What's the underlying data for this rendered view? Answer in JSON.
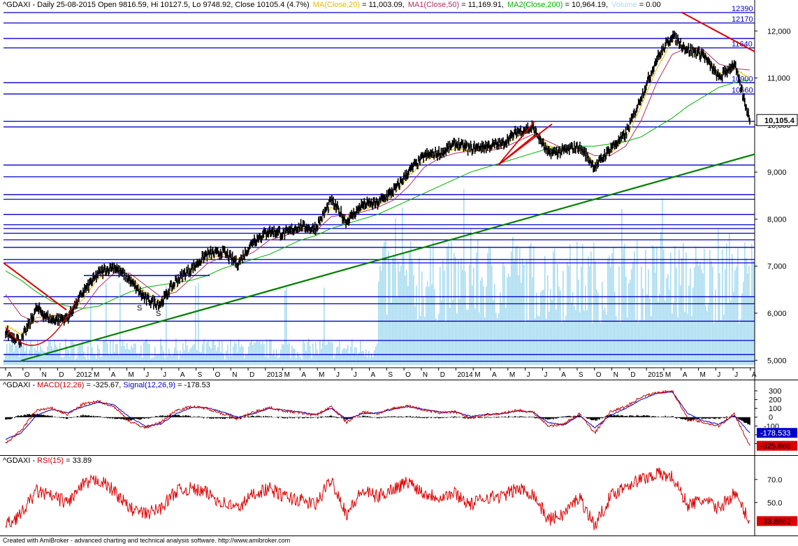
{
  "price_header": {
    "symbol_line": "^GDAXI - Daily 25-08-2015 Open 9816.59, Hi 10127.5, Lo 9748.92, Close 10105.4 (4.7%)",
    "ma20": "MA(Close,20)",
    "ma20_value": " = 11,003.09,",
    "ma50": "MA1(Close,50)",
    "ma50_value": " = 11,169.91,",
    "ma200": "MA2(Close,200)",
    "ma200_value": " = 10,964.19,",
    "volume": "Volume",
    "volume_value": " = 0.00"
  },
  "macd_header": {
    "symbol": "^GDAXI - ",
    "macd": "MACD(12,26)",
    "macd_value": " = -325.67, ",
    "signal": "Signal(12,26,9)",
    "signal_value": " = -178.53"
  },
  "rsi_header": {
    "symbol": "^GDAXI - ",
    "rsi": "RSI(15)",
    "rsi_value": " = 33.89"
  },
  "footer": "Created with AmiBroker - advanced charting and technical analysis software. http://www.amibroker.com",
  "colors": {
    "price": "#000000",
    "ma20": "#e8b800",
    "ma50": "#b03060",
    "ma200": "#00b000",
    "volume": "#a8dcf0",
    "hline": "#0000cc",
    "trend_green": "#008000",
    "trend_red": "#dd0000",
    "macd": "#cc0000",
    "signal": "#0000cc",
    "rsi": "#dd0000"
  },
  "chart_data": [
    {
      "type": "line",
      "title": "^GDAXI - Daily",
      "ylim": [
        4900,
        12450
      ],
      "y_ticks": [
        "5,000",
        "6,000",
        "7,000",
        "8,000",
        "9,000",
        "10,000",
        "11,000",
        "12,000"
      ],
      "x_labels": [
        "A",
        "O",
        "N",
        "D",
        "2012",
        "M",
        "A",
        "M",
        "J",
        "J",
        "A",
        "S",
        "O",
        "N",
        "D",
        "2013",
        "M",
        "A",
        "M",
        "J",
        "J",
        "A",
        "S",
        "O",
        "N",
        "D",
        "2014",
        "M",
        "A",
        "M",
        "J",
        "J",
        "A",
        "S",
        "O",
        "N",
        "D",
        "2015",
        "M",
        "A",
        "M",
        "J",
        "J",
        "A"
      ],
      "last_value_label": "10,105.4",
      "horizontal_levels": [
        12390,
        12170,
        11840,
        11640,
        10900,
        10660,
        10080,
        9960,
        9150,
        8900,
        8520,
        8420,
        8100,
        7880,
        7800,
        7700,
        7560,
        7400,
        7140,
        7070,
        6350,
        6200,
        5830,
        5420,
        5120,
        4980
      ],
      "level_labels": [
        "12390",
        "12170",
        "11640",
        "10900",
        "10660"
      ],
      "series": [
        {
          "name": "Close",
          "x": [
            "2011-08",
            "2011-09",
            "2011-10",
            "2011-11",
            "2011-12",
            "2012-01",
            "2012-02",
            "2012-03",
            "2012-04",
            "2012-05",
            "2012-06",
            "2012-07",
            "2012-08",
            "2012-09",
            "2012-10",
            "2012-11",
            "2012-12",
            "2013-01",
            "2013-02",
            "2013-03",
            "2013-04",
            "2013-05",
            "2013-06",
            "2013-07",
            "2013-08",
            "2013-09",
            "2013-10",
            "2013-11",
            "2013-12",
            "2014-01",
            "2014-02",
            "2014-03",
            "2014-04",
            "2014-05",
            "2014-06",
            "2014-07",
            "2014-08",
            "2014-09",
            "2014-10",
            "2014-11",
            "2014-12",
            "2015-01",
            "2015-02",
            "2015-03",
            "2015-04",
            "2015-05",
            "2015-06",
            "2015-07",
            "2015-08"
          ],
          "values": [
            5600,
            5400,
            6100,
            5850,
            5900,
            6450,
            6850,
            7000,
            6700,
            6300,
            6200,
            6700,
            6950,
            7250,
            7300,
            7050,
            7550,
            7750,
            7700,
            7850,
            7800,
            8400,
            7950,
            8300,
            8350,
            8600,
            9000,
            9350,
            9400,
            9600,
            9500,
            9550,
            9600,
            9850,
            9950,
            9400,
            9450,
            9550,
            9100,
            9500,
            9800,
            10600,
            11400,
            11900,
            11600,
            11500,
            11000,
            11300,
            10105
          ]
        },
        {
          "name": "MA(Close,20)",
          "values": [
            5750,
            5550,
            5900,
            5950,
            5950,
            6300,
            6750,
            6950,
            6800,
            6450,
            6250,
            6550,
            6900,
            7150,
            7250,
            7150,
            7450,
            7700,
            7700,
            7800,
            7750,
            8250,
            8050,
            8200,
            8300,
            8500,
            8900,
            9250,
            9350,
            9500,
            9450,
            9500,
            9550,
            9750,
            9900,
            9550,
            9450,
            9550,
            9200,
            9400,
            9700,
            10400,
            11200,
            11800,
            11650,
            11550,
            11100,
            11200,
            11003
          ]
        },
        {
          "name": "MA1(Close,50)",
          "values": [
            6400,
            5950,
            5800,
            5950,
            5950,
            6100,
            6550,
            6850,
            6850,
            6600,
            6350,
            6450,
            6750,
            7050,
            7200,
            7150,
            7300,
            7550,
            7650,
            7750,
            7750,
            8050,
            8100,
            8150,
            8250,
            8400,
            8700,
            9100,
            9300,
            9400,
            9450,
            9450,
            9500,
            9650,
            9800,
            9650,
            9500,
            9500,
            9350,
            9350,
            9550,
            10100,
            10900,
            11500,
            11650,
            11600,
            11300,
            11200,
            11170
          ]
        },
        {
          "name": "MA2(Close,200)",
          "values": [
            6900,
            6700,
            6450,
            6250,
            6150,
            6100,
            6150,
            6300,
            6450,
            6550,
            6600,
            6650,
            6700,
            6800,
            6950,
            7050,
            7150,
            7250,
            7400,
            7550,
            7650,
            7800,
            7900,
            8000,
            8100,
            8250,
            8400,
            8550,
            8700,
            8850,
            9000,
            9100,
            9200,
            9300,
            9400,
            9500,
            9550,
            9550,
            9550,
            9600,
            9650,
            9750,
            9950,
            10150,
            10400,
            10600,
            10800,
            10900,
            10964
          ]
        }
      ]
    },
    {
      "type": "line",
      "title": "^GDAXI - MACD(12,26)",
      "y_ticks": [
        "300",
        "200",
        "100",
        "0",
        "-100",
        "-200",
        "-300"
      ],
      "last_value_labels": [
        "-178.533",
        "-325.668"
      ],
      "series": [
        {
          "name": "MACD(12,26)",
          "values": [
            -300,
            -150,
            80,
            100,
            30,
            150,
            180,
            120,
            -50,
            -120,
            -60,
            80,
            120,
            100,
            40,
            -20,
            60,
            110,
            70,
            50,
            20,
            120,
            -60,
            60,
            40,
            100,
            130,
            80,
            50,
            60,
            -10,
            30,
            40,
            80,
            60,
            -100,
            -80,
            40,
            -180,
            60,
            120,
            230,
            280,
            300,
            -20,
            -60,
            -100,
            40,
            -326
          ]
        },
        {
          "name": "Signal(12,26,9)",
          "values": [
            -250,
            -180,
            20,
            90,
            50,
            120,
            170,
            140,
            0,
            -100,
            -80,
            40,
            110,
            110,
            60,
            0,
            40,
            100,
            80,
            60,
            30,
            100,
            -20,
            40,
            50,
            90,
            120,
            90,
            60,
            60,
            10,
            30,
            40,
            70,
            60,
            -60,
            -90,
            20,
            -120,
            20,
            100,
            200,
            270,
            290,
            40,
            -40,
            -80,
            20,
            -179
          ]
        }
      ]
    },
    {
      "type": "line",
      "title": "^GDAXI - RSI(15)",
      "y_ticks": [
        "70.0",
        "50.0"
      ],
      "last_value_label": "33.8862",
      "series": [
        {
          "name": "RSI(15)",
          "values": [
            30,
            40,
            60,
            55,
            50,
            65,
            70,
            60,
            45,
            40,
            45,
            60,
            62,
            58,
            50,
            45,
            58,
            62,
            55,
            52,
            48,
            70,
            40,
            60,
            55,
            62,
            68,
            58,
            55,
            58,
            48,
            55,
            55,
            62,
            58,
            35,
            40,
            55,
            30,
            55,
            65,
            70,
            75,
            72,
            48,
            52,
            45,
            58,
            34
          ]
        }
      ]
    }
  ]
}
